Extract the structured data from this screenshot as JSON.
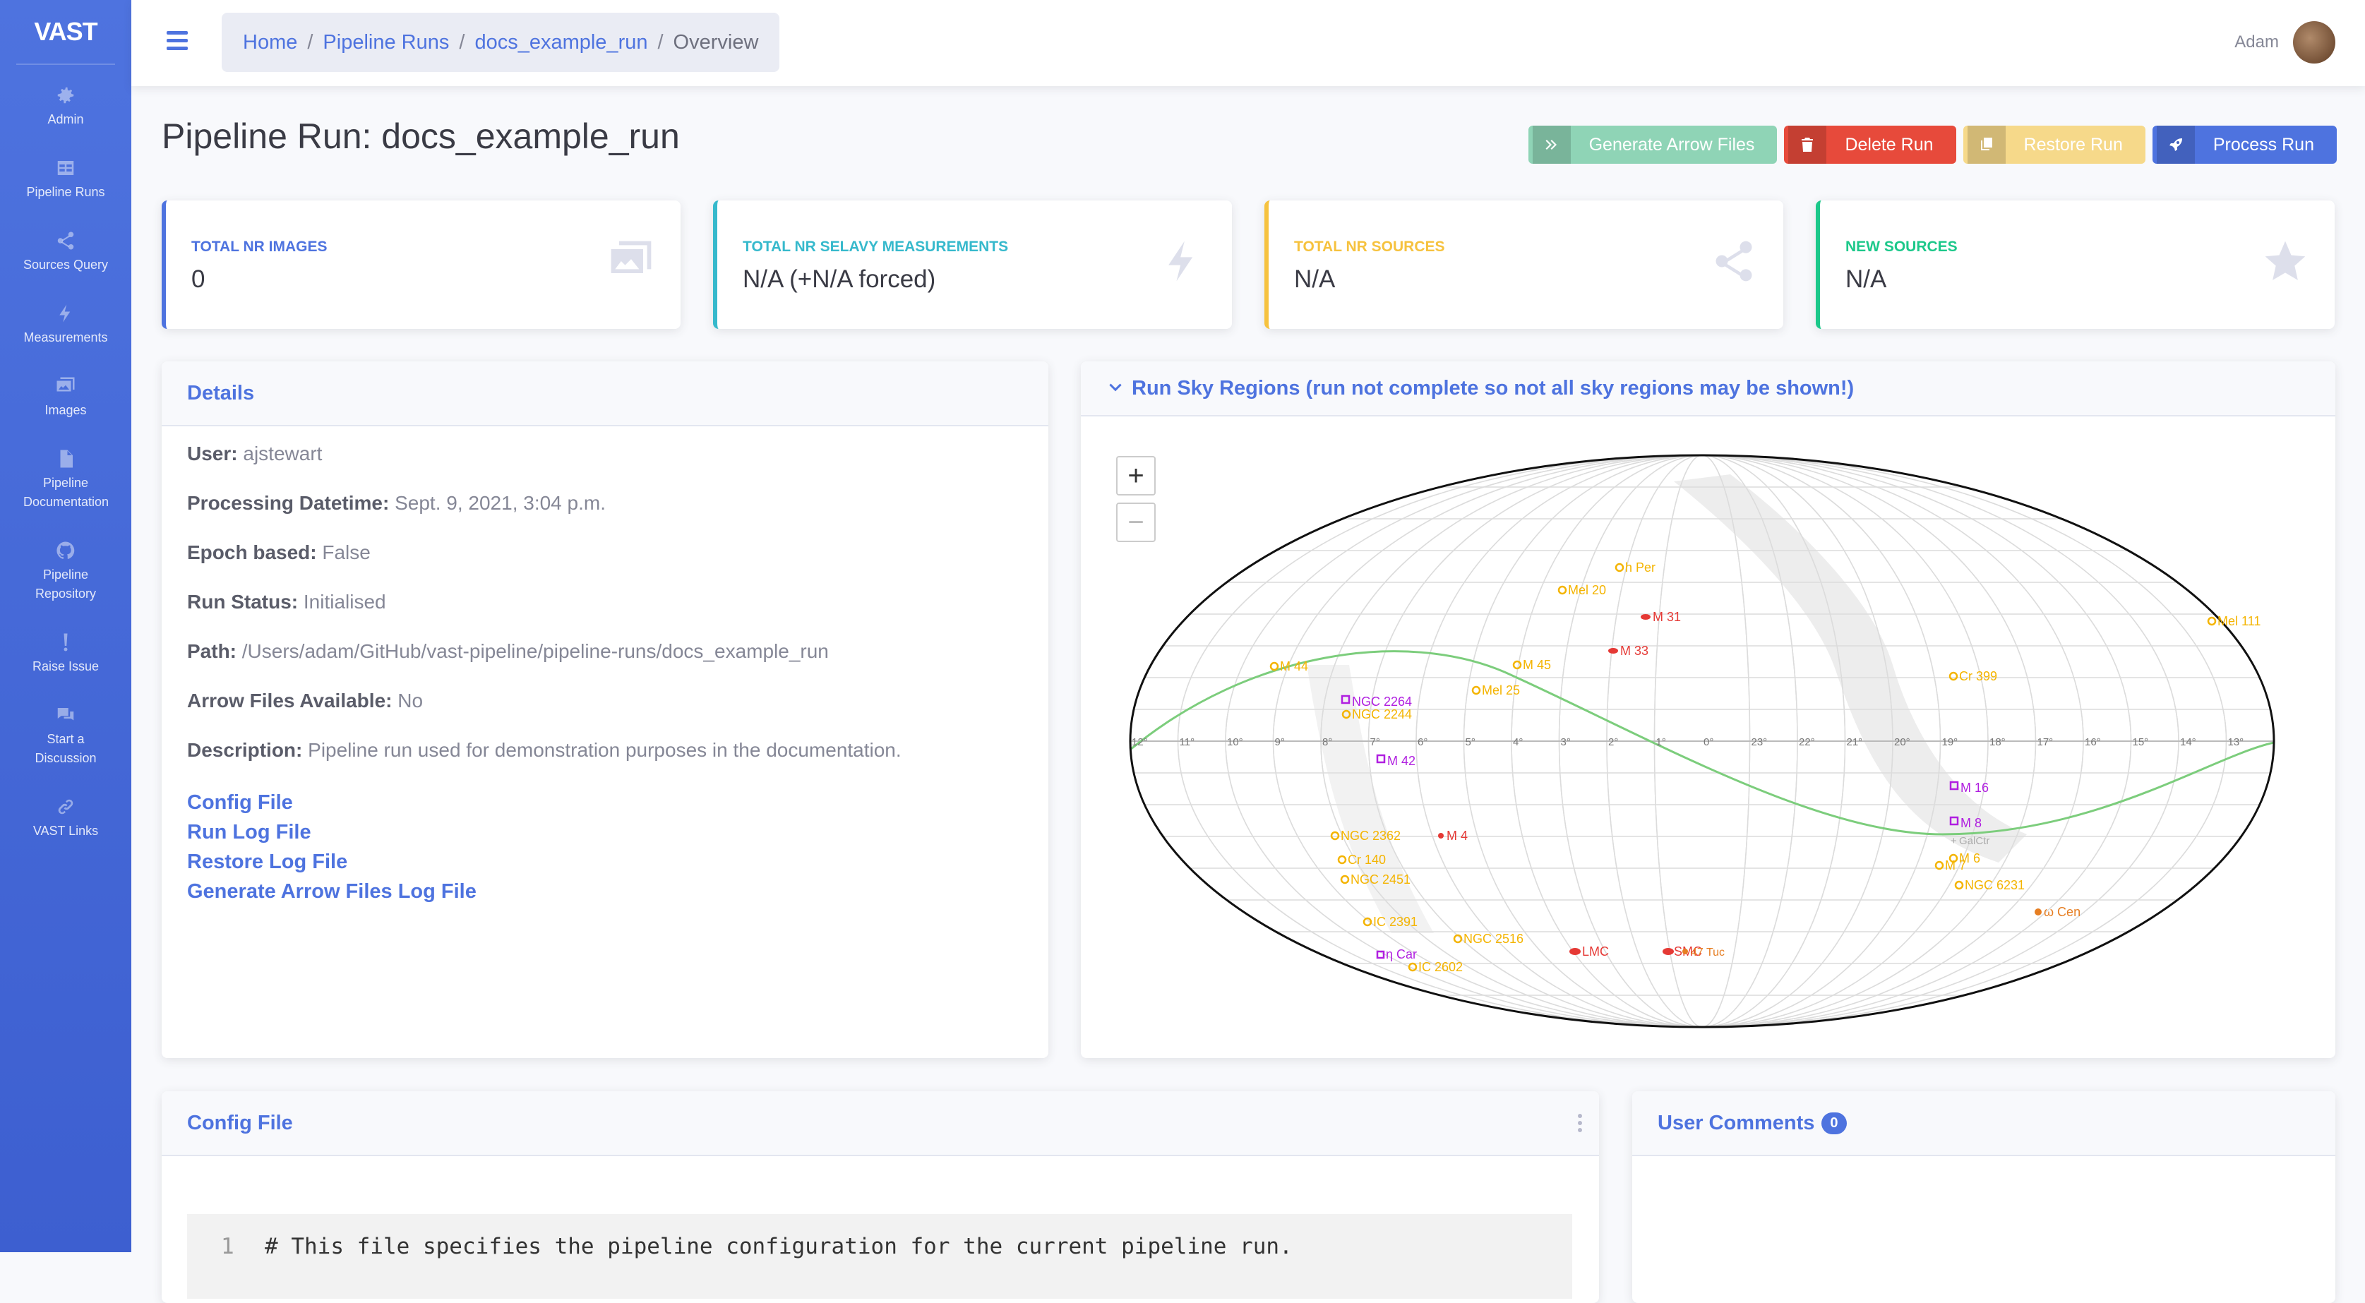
{
  "brand": {
    "logo": "VAST"
  },
  "sidebar": {
    "items": [
      {
        "label": "Admin",
        "icon": "gear-icon"
      },
      {
        "label": "Pipeline Runs",
        "icon": "table-icon"
      },
      {
        "label": "Sources Query",
        "icon": "share-icon"
      },
      {
        "label": "Measurements",
        "icon": "bolt-icon"
      },
      {
        "label": "Images",
        "icon": "images-icon"
      },
      {
        "label": "Pipeline Documentation",
        "icon": "file-icon"
      },
      {
        "label": "Pipeline Repository",
        "icon": "github-icon"
      },
      {
        "label": "Raise Issue",
        "icon": "exclamation-icon"
      },
      {
        "label": "Start a Discussion",
        "icon": "comments-icon"
      },
      {
        "label": "VAST Links",
        "icon": "link-icon"
      }
    ]
  },
  "topbar": {
    "breadcrumb": [
      "Home",
      "Pipeline Runs",
      "docs_example_run",
      "Overview"
    ],
    "user": "Adam"
  },
  "page": {
    "title": "Pipeline Run: docs_example_run"
  },
  "actions": {
    "generate": "Generate Arrow Files",
    "delete": "Delete Run",
    "restore": "Restore Run",
    "process": "Process Run"
  },
  "stats": [
    {
      "label": "Total Nr Images",
      "value": "0",
      "color": "#4e73df"
    },
    {
      "label": "Total Nr Selavy Measurements",
      "value": "N/A (+N/A forced)",
      "color": "#36b9cc"
    },
    {
      "label": "Total Nr Sources",
      "value": "N/A",
      "color": "#f6c23e"
    },
    {
      "label": "New Sources",
      "value": "N/A",
      "color": "#1cc88a"
    }
  ],
  "details": {
    "title": "Details",
    "user_label": "User:",
    "user": "ajstewart",
    "datetime_label": "Processing Datetime:",
    "datetime": "Sept. 9, 2021, 3:04 p.m.",
    "epoch_label": "Epoch based:",
    "epoch": "False",
    "status_label": "Run Status:",
    "status": "Initialised",
    "path_label": "Path:",
    "path": "/Users/adam/GitHub/vast-pipeline/pipeline-runs/docs_example_run",
    "arrow_label": "Arrow Files Available:",
    "arrow": "No",
    "desc_label": "Description:",
    "desc": "Pipeline run used for demonstration purposes in the documentation.",
    "links": [
      "Config File",
      "Run Log File",
      "Restore Log File",
      "Generate Arrow Files Log File"
    ]
  },
  "sky": {
    "title": "Run Sky Regions (run not complete so not all sky regions may be shown!)",
    "zoom_in": "+",
    "zoom_out": "−",
    "ra_labels": [
      "12°",
      "11°",
      "10°",
      "9°",
      "8°",
      "7°",
      "6°",
      "5°",
      "4°",
      "3°",
      "2°",
      "1°",
      "0°",
      "23°",
      "22°",
      "21°",
      "20°",
      "19°",
      "18°",
      "17°",
      "16°",
      "15°",
      "14°",
      "13°"
    ],
    "objects": [
      {
        "name": "h Per",
        "kind": "cluster"
      },
      {
        "name": "Mel 20",
        "kind": "cluster"
      },
      {
        "name": "M 31",
        "kind": "galaxy"
      },
      {
        "name": "M 33",
        "kind": "galaxy"
      },
      {
        "name": "Mel 111",
        "kind": "cluster"
      },
      {
        "name": "M 44",
        "kind": "cluster"
      },
      {
        "name": "M 45",
        "kind": "cluster"
      },
      {
        "name": "Mel 25",
        "kind": "cluster"
      },
      {
        "name": "Cr 399",
        "kind": "cluster"
      },
      {
        "name": "NGC 2264",
        "kind": "nebula"
      },
      {
        "name": "NGC 2244",
        "kind": "cluster"
      },
      {
        "name": "M 42",
        "kind": "nebula"
      },
      {
        "name": "M 16",
        "kind": "nebula"
      },
      {
        "name": "M 8",
        "kind": "nebula"
      },
      {
        "name": "GalCtr",
        "kind": "marker"
      },
      {
        "name": "M 6",
        "kind": "cluster"
      },
      {
        "name": "M 7",
        "kind": "cluster"
      },
      {
        "name": "NGC 2362",
        "kind": "cluster"
      },
      {
        "name": "M 4",
        "kind": "galaxy"
      },
      {
        "name": "Cr 140",
        "kind": "cluster"
      },
      {
        "name": "NGC 2451",
        "kind": "cluster"
      },
      {
        "name": "NGC 6231",
        "kind": "cluster"
      },
      {
        "name": "IC 2391",
        "kind": "cluster"
      },
      {
        "name": "NGC 2516",
        "kind": "cluster"
      },
      {
        "name": "ω Cen",
        "kind": "globular"
      },
      {
        "name": "LMC",
        "kind": "galaxy"
      },
      {
        "name": "SMC",
        "kind": "galaxy"
      },
      {
        "name": "47 Tuc",
        "kind": "globular"
      },
      {
        "name": "η Car",
        "kind": "nebula"
      },
      {
        "name": "IC 2602",
        "kind": "cluster"
      }
    ]
  },
  "config": {
    "title": "Config File",
    "line_no": "1",
    "line": "# This file specifies the pipeline configuration for the current pipeline run."
  },
  "comments": {
    "title": "User Comments",
    "count": "0"
  }
}
